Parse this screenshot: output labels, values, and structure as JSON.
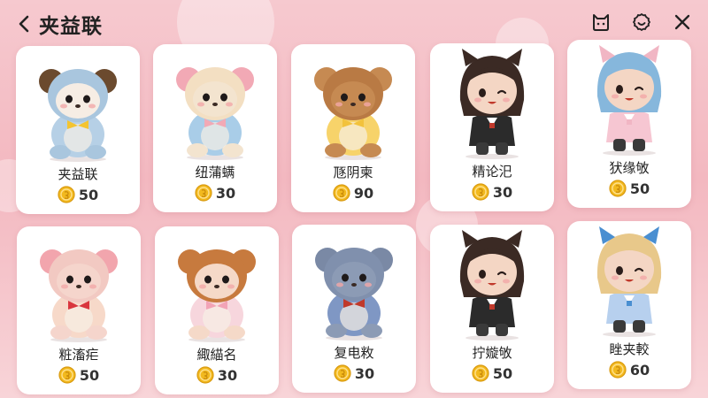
{
  "header": {
    "title": "夹益联",
    "back_icon": "chevron-left-icon",
    "actions": [
      "cat-face-icon",
      "smile-icon",
      "close-icon"
    ]
  },
  "colors": {
    "background": "#f3b8c0",
    "card": "#ffffff",
    "coin": "#f2b91e"
  },
  "items": [
    {
      "name": "夹益联",
      "price": "50",
      "figure": "blue dog plush with yellow bow"
    },
    {
      "name": "纽蒲螨",
      "price": "30",
      "figure": "cream bunny plush with pink bows"
    },
    {
      "name": "豗阴柬",
      "price": "90",
      "figure": "brown bear plush with yellow shirt"
    },
    {
      "name": "精论汜",
      "price": "30",
      "figure": "cat-ear girl figure in black uniform"
    },
    {
      "name": "犾缘敂",
      "price": "50",
      "figure": "blue-haired girl figure in pink hat"
    },
    {
      "name": "粧滀疟",
      "price": "50",
      "figure": "pink bunny plush with red bow"
    },
    {
      "name": "緅緢名",
      "price": "30",
      "figure": "orange braided girl plush"
    },
    {
      "name": "复电敉",
      "price": "30",
      "figure": "grey bear plush with blue jacket"
    },
    {
      "name": "拧嫙敂",
      "price": "50",
      "figure": "cat-ear girl figure in black jacket"
    },
    {
      "name": "睉夹較",
      "price": "60",
      "figure": "blonde girl figure with blue bow"
    }
  ]
}
